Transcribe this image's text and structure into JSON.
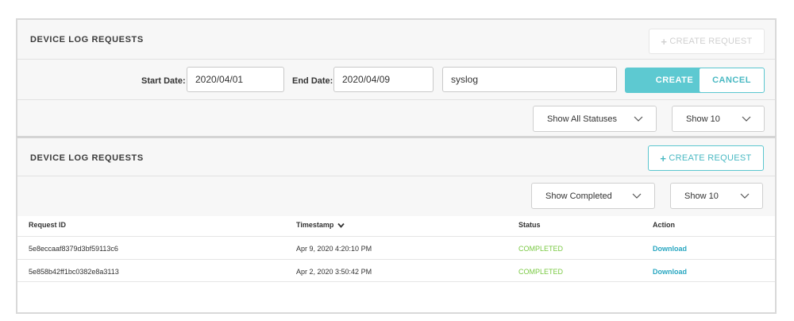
{
  "top_panel": {
    "title": "DEVICE LOG REQUESTS",
    "create_request_label": "CREATE REQUEST",
    "start_date_label": "Start Date:",
    "start_date_value": "2020/04/01",
    "end_date_label": "End Date:",
    "end_date_value": "2020/04/09",
    "log_type_value": "syslog",
    "create_label": "CREATE",
    "cancel_label": "CANCEL",
    "status_filter": "Show All Statuses",
    "page_size": "Show 10"
  },
  "bottom_panel": {
    "title": "DEVICE LOG REQUESTS",
    "create_request_label": "CREATE REQUEST",
    "status_filter": "Show Completed",
    "page_size": "Show 10",
    "columns": [
      "Request ID",
      "Timestamp",
      "Status",
      "Action"
    ],
    "rows": [
      {
        "id": "5e8eccaaf8379d3bf59113c6",
        "timestamp": "Apr 9, 2020 4:20:10 PM",
        "status": "COMPLETED",
        "action": "Download"
      },
      {
        "id": "5e858b42ff1bc0382e8a3113",
        "timestamp": "Apr 2, 2020 3:50:42 PM",
        "status": "COMPLETED",
        "action": "Download"
      }
    ]
  },
  "colors": {
    "accent": "#5dc9d1",
    "success": "#7ac943",
    "link": "#29a7c1"
  },
  "icons": {
    "plus": "plus-icon",
    "chevron": "chevron-down-icon",
    "sort": "sort-desc-icon"
  }
}
